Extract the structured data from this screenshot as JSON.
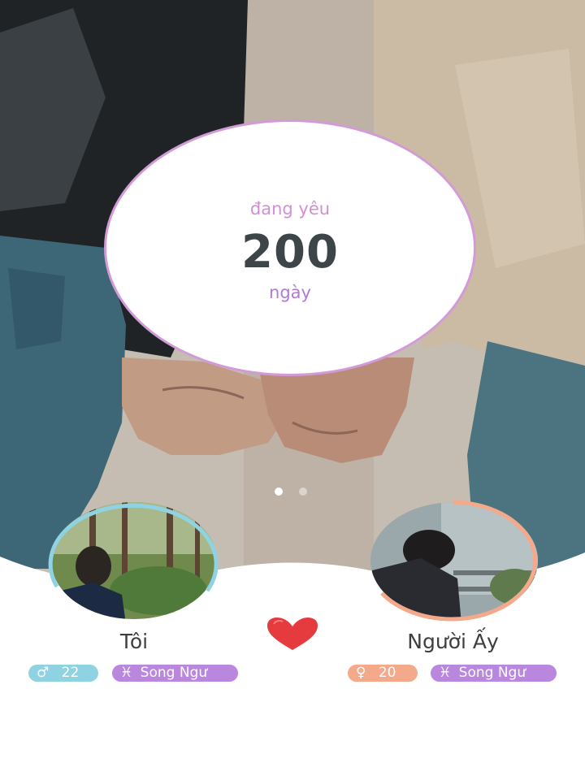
{
  "counter": {
    "label_top": "đang yêu",
    "days": "200",
    "label_bottom": "ngày"
  },
  "carousel": {
    "pages": 2,
    "active_page": 1
  },
  "me": {
    "name": "Tôi",
    "gender_symbol": "♂",
    "age": "22",
    "zodiac_symbol": "♓",
    "zodiac": "Song Ngư",
    "ring_color": "#8fd3e3",
    "chip_color": "#8fd3e3"
  },
  "partner": {
    "name": "Người Ấy",
    "gender_symbol": "♀",
    "age": "20",
    "zodiac_symbol": "♓",
    "zodiac": "Song Ngư",
    "ring_color": "#f3a98a",
    "chip_color": "#f3a98a"
  },
  "zodiac_chip_color": "#b987de",
  "heart_icon": "heart-icon",
  "colors": {
    "ring": "#d39ad8",
    "days": "#3d4548"
  }
}
